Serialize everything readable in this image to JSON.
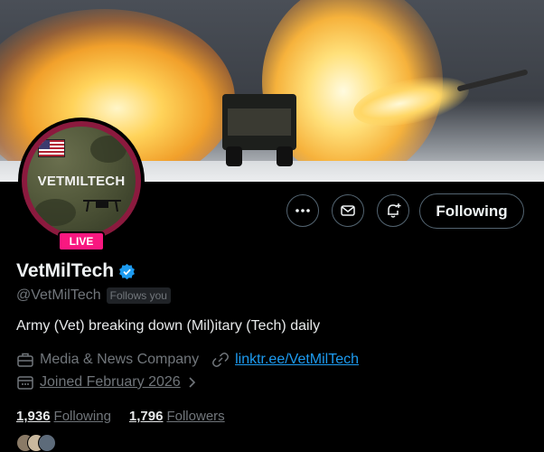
{
  "profile": {
    "avatar_text": "VETMILTECH",
    "live_badge": "LIVE",
    "display_name": "VetMilTech",
    "handle": "@VetMilTech",
    "follows_you": "Follows you",
    "bio": "Army (Vet) breaking down (Mil)itary (Tech) daily",
    "category": "Media & News Company",
    "link": "linktr.ee/VetMilTech",
    "joined": "Joined February 2026"
  },
  "actions": {
    "more": "more-icon",
    "message": "envelope-icon",
    "notifications": "bell-plus-icon",
    "follow_label": "Following"
  },
  "stats": {
    "following_count": "1,936",
    "following_label": "Following",
    "followers_count": "1,796",
    "followers_label": "Followers"
  },
  "colors": {
    "accent": "#1d9bf0",
    "live": "#f91880",
    "avatar_border": "#8b1a3e"
  }
}
